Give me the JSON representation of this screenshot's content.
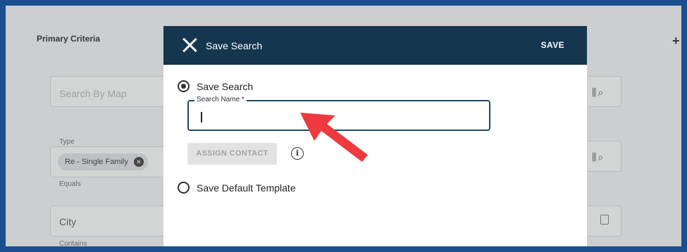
{
  "background": {
    "section_title": "Primary Criteria",
    "map_search_placeholder": "Search By Map",
    "type_label": "Type",
    "type_chip": "Re - Single Family",
    "type_operator": "Equals",
    "city_field": "City",
    "city_operator": "Contains"
  },
  "modal": {
    "title": "Save Search",
    "save_label": "SAVE",
    "option_save_search": "Save Search",
    "search_name_label": "Search Name *",
    "search_name_value": "",
    "assign_contact_label": "ASSIGN CONTACT",
    "option_default_template": "Save Default Template"
  },
  "colors": {
    "header": "#14364f",
    "border_frame": "#1a4e8f",
    "arrow": "#ec3a3f"
  }
}
